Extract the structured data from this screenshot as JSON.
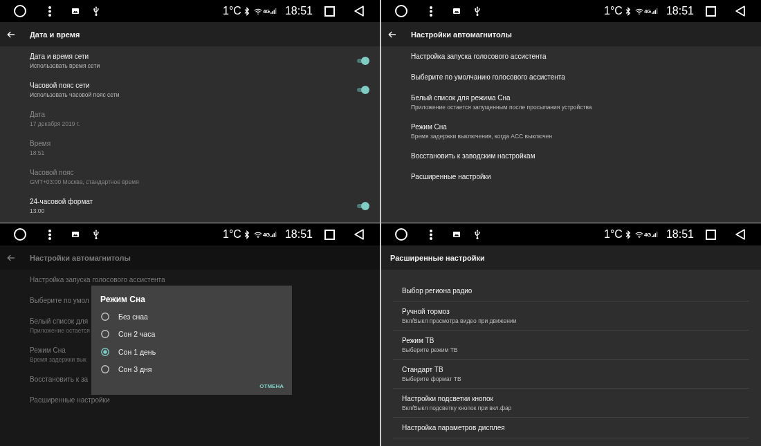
{
  "screens": [
    {
      "kind": "plain",
      "status_bar": {
        "temperature": "1°C",
        "network": "4G",
        "time": "18:51"
      },
      "app_bar": {
        "back": true,
        "title": "Дата и время"
      },
      "items": [
        {
          "kind": "toggle",
          "title": "Дата и время сети",
          "subtitle": "Использовать время сети",
          "disabled": false,
          "on": true
        },
        {
          "kind": "toggle",
          "title": "Часовой пояс сети",
          "subtitle": "Использовать часовой пояс сети",
          "disabled": false,
          "on": true
        },
        {
          "kind": "text",
          "title": "Дата",
          "subtitle": "17 декабря 2019 г.",
          "disabled": true
        },
        {
          "kind": "text",
          "title": "Время",
          "subtitle": "18:51",
          "disabled": true
        },
        {
          "kind": "text",
          "title": "Часовой пояс",
          "subtitle": "GMT+03:00 Москва, стандартное время",
          "disabled": true
        },
        {
          "kind": "toggle",
          "title": "24-часовой формат",
          "subtitle": "13:00",
          "disabled": false,
          "on": true
        }
      ]
    },
    {
      "kind": "plain",
      "status_bar": {
        "temperature": "1°C",
        "network": "4G",
        "time": "18:51"
      },
      "app_bar": {
        "back": true,
        "title": "Настройки автомагнитолы"
      },
      "items": [
        {
          "kind": "text",
          "title": "Настройка запуска голосового ассистента"
        },
        {
          "kind": "text",
          "title": "Выберите по умолчанию голосового ассистента"
        },
        {
          "kind": "text",
          "title": "Белый список для режима Сна",
          "subtitle": "Приложение остается запущенным после просыпания устройства"
        },
        {
          "kind": "text",
          "title": "Режим Сна",
          "subtitle": "Время задержки выключения, когда ACC выключен"
        },
        {
          "kind": "text",
          "title": "Восстановить к заводским настройкам"
        },
        {
          "kind": "text",
          "title": "Расширенные настройки"
        }
      ]
    },
    {
      "kind": "plain",
      "status_bar": {
        "temperature": "1°C",
        "network": "4G",
        "time": "18:51"
      },
      "app_bar": {
        "back": true,
        "title": "Настройки автомагнитолы"
      },
      "items": [
        {
          "kind": "text",
          "title": "Настройка запуска голосового ассистента"
        },
        {
          "kind": "text",
          "title": "Выберите по умол"
        },
        {
          "kind": "text",
          "title": "Белый список для",
          "subtitle": "Приложение остается"
        },
        {
          "kind": "text",
          "title": "Режим Сна",
          "subtitle": "Время задержки вык"
        },
        {
          "kind": "text",
          "title": "Восстановить к за"
        },
        {
          "kind": "text",
          "title": "Расширенные настройки"
        }
      ],
      "dialog": {
        "title": "Режим Сна",
        "options": [
          {
            "label": "Без снаа",
            "selected": false
          },
          {
            "label": "Сон 2 часа",
            "selected": false
          },
          {
            "label": "Сон 1 день",
            "selected": true
          },
          {
            "label": "Сон 3 дня",
            "selected": false
          }
        ],
        "buttons": [
          "ОТМЕНА"
        ]
      }
    },
    {
      "kind": "divided",
      "status_bar": {
        "temperature": "1°C",
        "network": "4G",
        "time": "18:51"
      },
      "app_bar": {
        "back": false,
        "title": "Расширенные настройки"
      },
      "items": [
        {
          "kind": "text",
          "title": "Выбор региона радио"
        },
        {
          "kind": "text",
          "title": "Ручной тормоз",
          "subtitle": "Вкл/Выкл просмотра видео при движении"
        },
        {
          "kind": "text",
          "title": "Режим ТВ",
          "subtitle": "Выберите режим ТВ"
        },
        {
          "kind": "text",
          "title": "Стандарт ТВ",
          "subtitle": "Выберите формат ТВ"
        },
        {
          "kind": "text",
          "title": "Настройки подсветки кнопок",
          "subtitle": "Вкл/Выкл подсветку кнопок при вкл.фар"
        },
        {
          "kind": "text",
          "title": "Настройка параметров дисплея"
        }
      ]
    }
  ]
}
